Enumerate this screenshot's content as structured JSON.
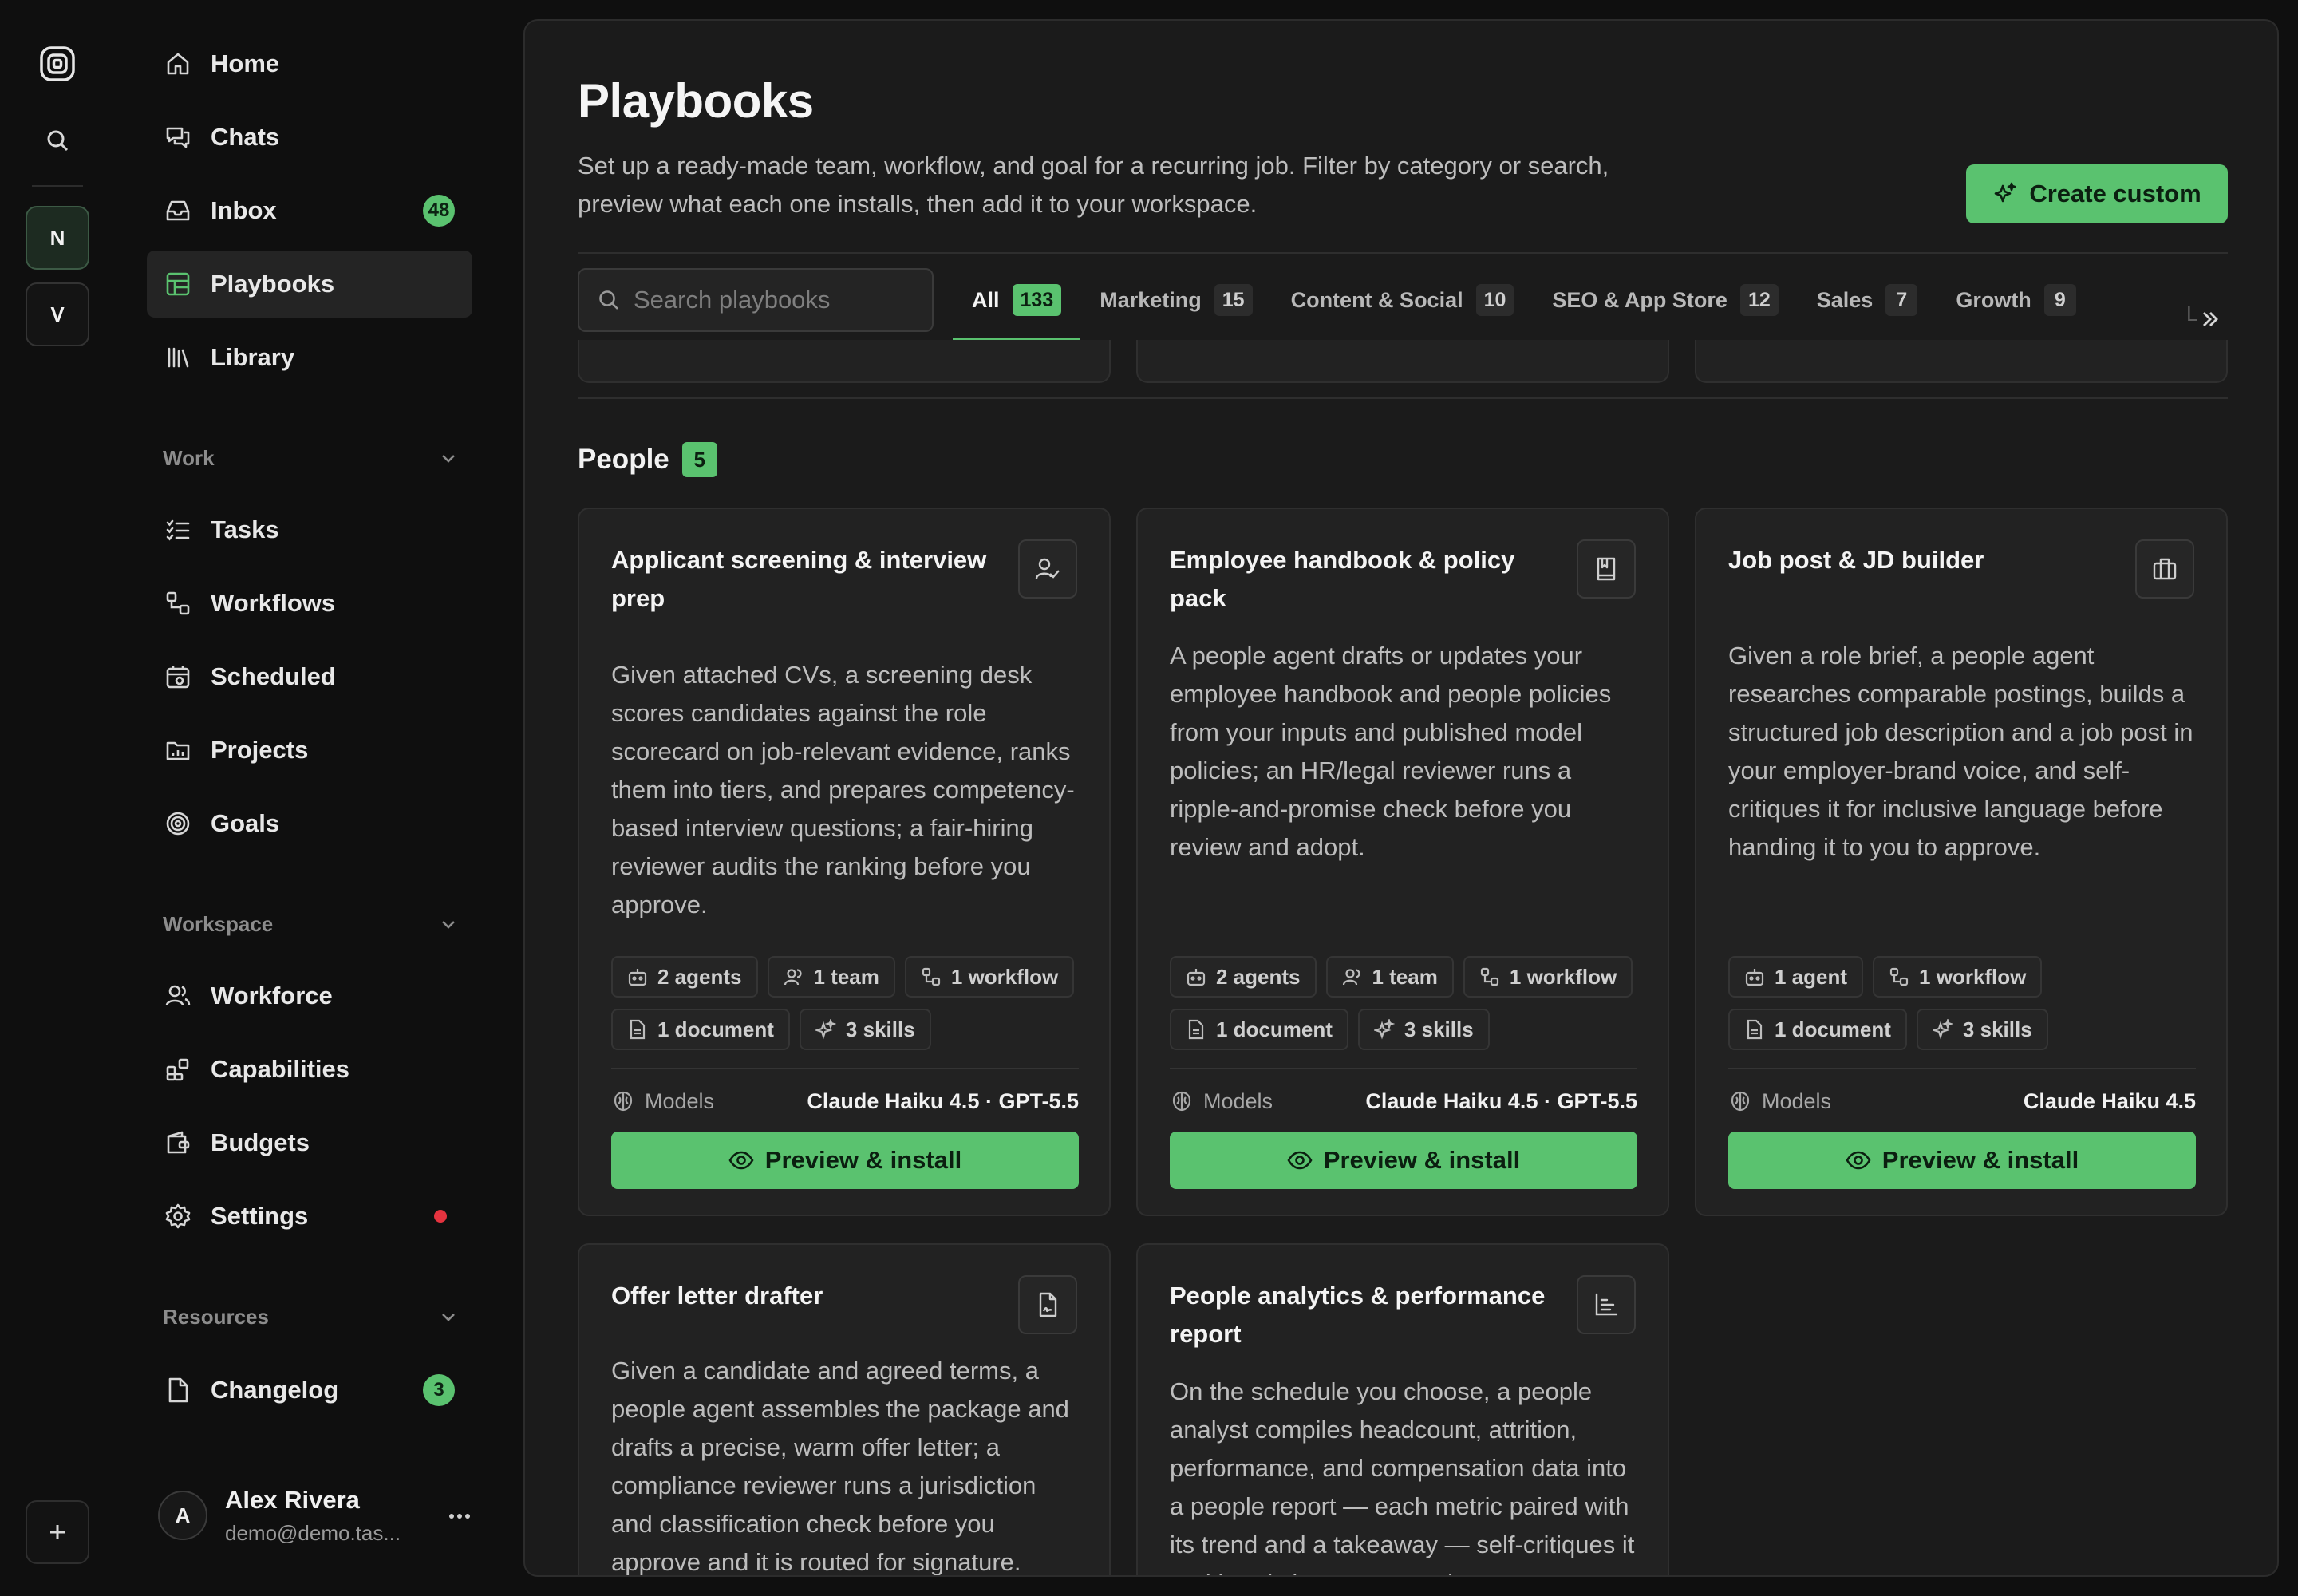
{
  "rail": {
    "workspaces": [
      "N",
      "V"
    ]
  },
  "sidebar": {
    "nav": [
      {
        "label": "Home",
        "icon": "home-icon"
      },
      {
        "label": "Chats",
        "icon": "chats-icon"
      },
      {
        "label": "Inbox",
        "icon": "inbox-icon",
        "badge": "48"
      },
      {
        "label": "Playbooks",
        "icon": "playbooks-icon"
      },
      {
        "label": "Library",
        "icon": "library-icon"
      }
    ],
    "work": {
      "title": "Work",
      "items": [
        {
          "label": "Tasks",
          "icon": "tasks-icon"
        },
        {
          "label": "Workflows",
          "icon": "workflows-icon"
        },
        {
          "label": "Scheduled",
          "icon": "calendar-icon"
        },
        {
          "label": "Projects",
          "icon": "projects-icon"
        },
        {
          "label": "Goals",
          "icon": "target-icon"
        }
      ]
    },
    "workspace": {
      "title": "Workspace",
      "items": [
        {
          "label": "Workforce",
          "icon": "users-icon"
        },
        {
          "label": "Capabilities",
          "icon": "capabilities-icon"
        },
        {
          "label": "Budgets",
          "icon": "wallet-icon"
        },
        {
          "label": "Settings",
          "icon": "gear-icon"
        }
      ]
    },
    "resources": {
      "title": "Resources",
      "items": [
        {
          "label": "Changelog",
          "icon": "file-icon",
          "badge": "3"
        }
      ]
    },
    "user": {
      "initial": "A",
      "name": "Alex Rivera",
      "email": "demo@demo.tas..."
    }
  },
  "main": {
    "title": "Playbooks",
    "description": "Set up a ready-made team, workflow, and goal for a recurring job. Filter by category or search, preview what each one installs, then add it to your workspace.",
    "create_label": "Create custom",
    "search_placeholder": "Search playbooks",
    "tabs": [
      {
        "label": "All",
        "count": "133"
      },
      {
        "label": "Marketing",
        "count": "15"
      },
      {
        "label": "Content & Social",
        "count": "10"
      },
      {
        "label": "SEO & App Store",
        "count": "12"
      },
      {
        "label": "Sales",
        "count": "7"
      },
      {
        "label": "Growth",
        "count": "9"
      }
    ],
    "tab_overflow_text": "L",
    "group": {
      "title": "People",
      "count": "5"
    },
    "models_label": "Models",
    "install_label": "Preview & install",
    "cards": [
      {
        "title": "Applicant screening & interview prep",
        "icon": "user-check-icon",
        "description": "Given attached CVs, a screening desk scores candidates against the role scorecard on job-relevant evidence, ranks them into tiers, and prepares competency-based interview questions; a fair-hiring reviewer audits the ranking before you approve.",
        "chips": [
          "2 agents",
          "1 team",
          "1 workflow",
          "1 document",
          "3 skills"
        ],
        "models": "Claude Haiku 4.5 · GPT-5.5"
      },
      {
        "title": "Employee handbook & policy pack",
        "icon": "book-icon",
        "description": "A people agent drafts or updates your employee handbook and people policies from your inputs and published model policies; an HR/legal reviewer runs a ripple-and-promise check before you review and adopt.",
        "chips": [
          "2 agents",
          "1 team",
          "1 workflow",
          "1 document",
          "3 skills"
        ],
        "models": "Claude Haiku 4.5 · GPT-5.5"
      },
      {
        "title": "Job post & JD builder",
        "icon": "briefcase-icon",
        "description": "Given a role brief, a people agent researches comparable postings, builds a structured job description and a job post in your employer-brand voice, and self-critiques it for inclusive language before handing it to you to approve.",
        "chips": [
          "1 agent",
          "1 workflow",
          "1 document",
          "3 skills"
        ],
        "models": "Claude Haiku 4.5"
      },
      {
        "title": "Offer letter drafter",
        "icon": "file-signature-icon",
        "description": "Given a candidate and agreed terms, a people agent assembles the package and drafts a precise, warm offer letter; a compliance reviewer runs a jurisdiction and classification check before you approve and it is routed for signature."
      },
      {
        "title": "People analytics & performance report",
        "icon": "bar-chart-icon",
        "description": "On the schedule you choose, a people analyst compiles headcount, attrition, performance, and compensation data into a people report — each metric paired with its trend and a takeaway — self-critiques it and hands it to you to review."
      }
    ]
  },
  "colors": {
    "accent": "#5ac26f",
    "background": "#0f0f0f",
    "panel": "#1b1b1b",
    "card": "#222222",
    "alert": "#e5333f"
  }
}
